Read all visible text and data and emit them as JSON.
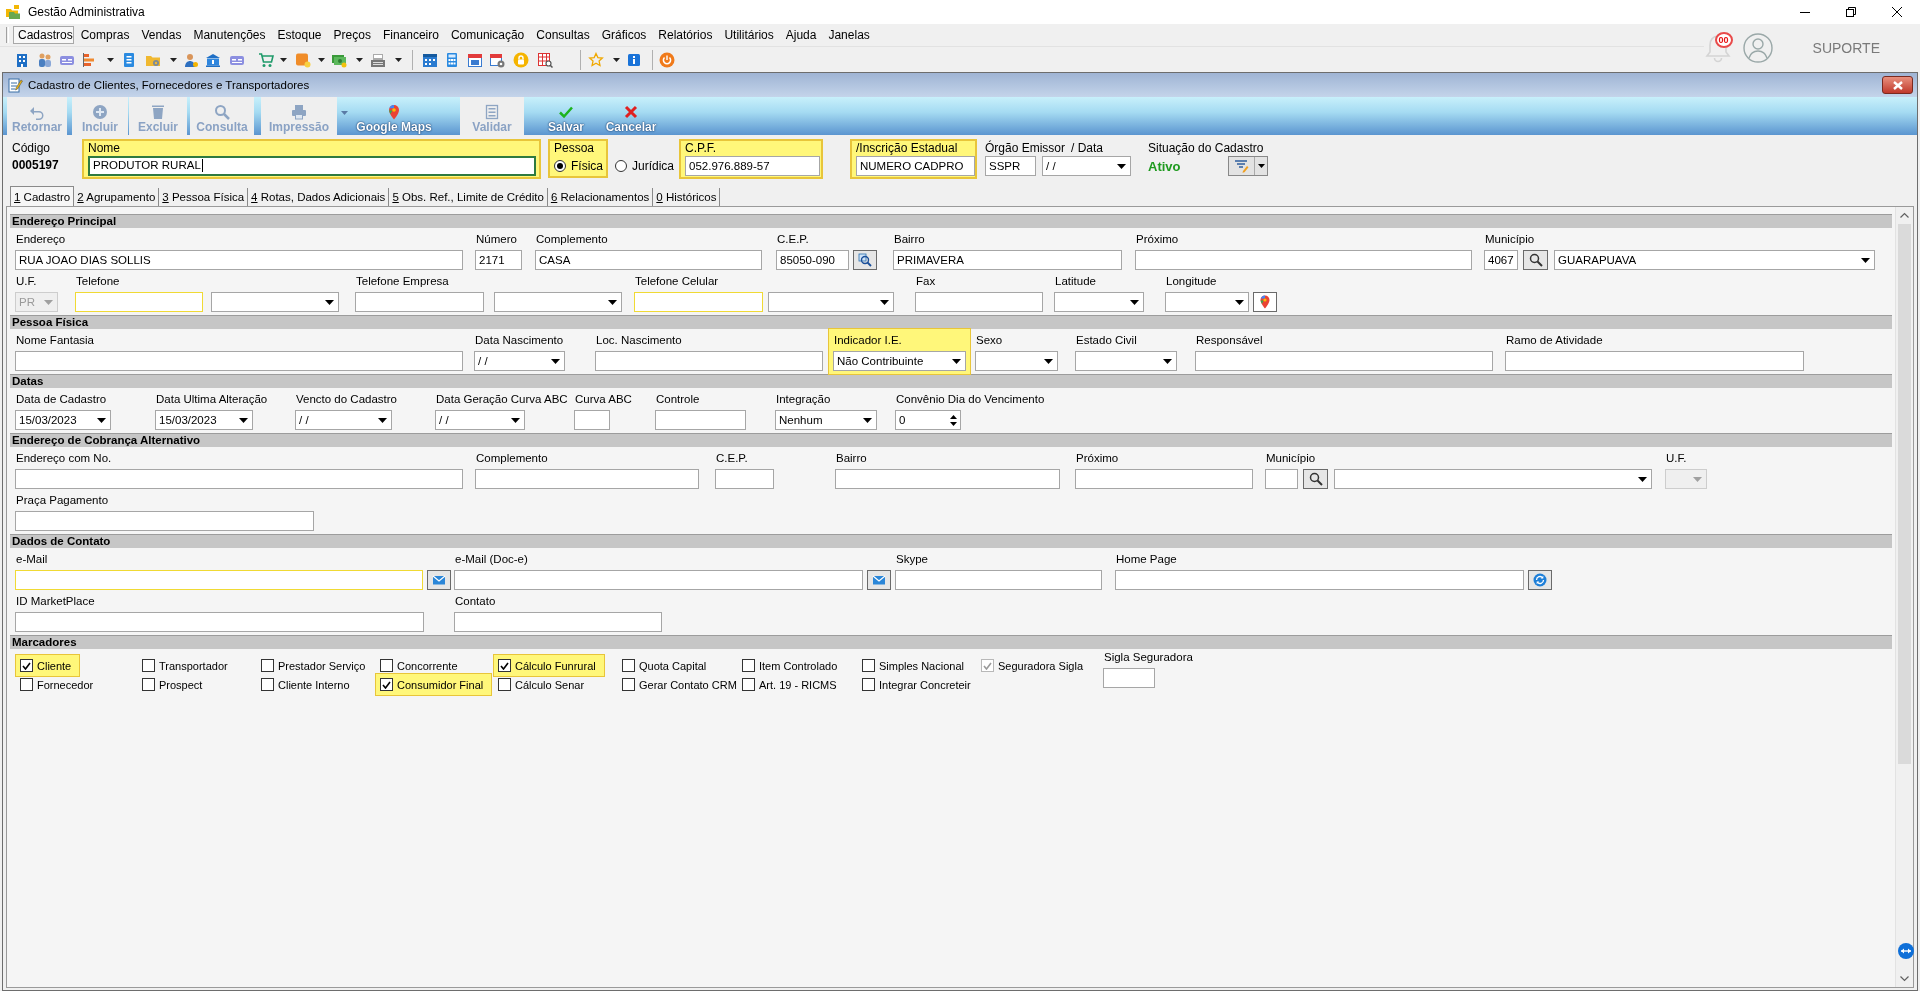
{
  "app": {
    "title": "Gestão Administrativa",
    "menu": [
      {
        "label": "Cadastros",
        "selected": true
      },
      {
        "label": "Compras",
        "selected": false
      },
      {
        "label": "Vendas",
        "selected": false
      },
      {
        "label": "Manutenções",
        "selected": false
      },
      {
        "label": "Estoque",
        "selected": false
      },
      {
        "label": "Preços",
        "selected": false
      },
      {
        "label": "Financeiro",
        "selected": false
      },
      {
        "label": "Comunicação",
        "selected": false
      },
      {
        "label": "Consultas",
        "selected": false
      },
      {
        "label": "Gráficos",
        "selected": false
      },
      {
        "label": "Relatórios",
        "selected": false
      },
      {
        "label": "Utilitários",
        "selected": false
      },
      {
        "label": "Ajuda",
        "selected": false
      },
      {
        "label": "Janelas",
        "selected": false
      }
    ],
    "notifications": "00",
    "support": "SUPORTE"
  },
  "form_window": {
    "title": "Cadastro de Clientes, Fornecedores e Transportadores",
    "toolbar": [
      {
        "label": "Retornar",
        "disabled": true
      },
      {
        "label": "Incluir",
        "disabled": true
      },
      {
        "label": "Excluir",
        "disabled": true
      },
      {
        "label": "Consulta",
        "disabled": true
      },
      {
        "label": "Impressão",
        "disabled": true,
        "dropdown": true
      },
      {
        "label": "Google Maps",
        "disabled": false
      },
      {
        "label": "Validar",
        "disabled": true
      },
      {
        "label": "Salvar",
        "disabled": false
      },
      {
        "label": "Cancelar",
        "disabled": false
      }
    ]
  },
  "record": {
    "code": {
      "label": "Código",
      "value": "0005197"
    },
    "name": {
      "label": "Nome",
      "value": "PRODUTOR RURAL",
      "highlighted": true,
      "focused": true
    },
    "person_type": {
      "label": "Pessoa",
      "highlighted": true,
      "options": [
        {
          "label": "Física",
          "selected": true
        },
        {
          "label": "Jurídica",
          "selected": false
        }
      ]
    },
    "cpf": {
      "label": "C.P.F.",
      "value": "052.976.889-57",
      "highlighted": true
    },
    "state_registration": {
      "label": "/Inscrição Estadual",
      "value": "NUMERO CADPRO",
      "highlighted": true
    },
    "issuer": {
      "label": "Órgão Emissor",
      "value": "SSPR",
      "date_label": "/ Data",
      "date": "/ /"
    },
    "status": {
      "label": "Situação do Cadastro",
      "value": "Ativo"
    }
  },
  "tabs": [
    {
      "label": "1 Cadastro",
      "selected": true
    },
    {
      "label": "2 Agrupamento",
      "selected": false
    },
    {
      "label": "3 Pessoa Física",
      "selected": false
    },
    {
      "label": "4 Rotas, Dados Adicionais",
      "selected": false
    },
    {
      "label": "5 Obs. Ref., Limite de Crédito",
      "selected": false
    },
    {
      "label": "6 Relacionamentos",
      "selected": false
    },
    {
      "label": "0 Históricos",
      "selected": false
    }
  ],
  "sections": [
    {
      "title": "Endereço Principal",
      "fields": [
        {
          "label": "Endereço",
          "kind": "text",
          "value": "RUA JOAO DIAS SOLLIS",
          "disabled": false,
          "required": false,
          "highlighted": false
        },
        {
          "label": "Número",
          "kind": "text",
          "value": "2171",
          "disabled": false,
          "required": false,
          "highlighted": false
        },
        {
          "label": "Complemento",
          "kind": "text",
          "value": "CASA",
          "disabled": false,
          "required": false,
          "highlighted": false
        },
        {
          "label": "C.E.P.",
          "kind": "text",
          "value": "85050-090",
          "disabled": false,
          "required": false,
          "highlighted": false
        },
        {
          "label": "Bairro",
          "kind": "text",
          "value": "PRIMAVERA",
          "disabled": false,
          "required": false,
          "highlighted": false
        },
        {
          "label": "Próximo",
          "kind": "text",
          "disabled": false,
          "required": false,
          "highlighted": false
        },
        {
          "label": "Município",
          "kind": "lookup",
          "value": "4067",
          "selection": "GUARAPUAVA",
          "disabled": false,
          "required": false,
          "highlighted": false
        },
        {
          "label": "U.F.",
          "kind": "select",
          "value": "PR",
          "disabled": true,
          "required": false,
          "highlighted": false
        },
        {
          "label": "Telefone",
          "kind": "text",
          "disabled": false,
          "required": true,
          "highlighted": false
        },
        {
          "kind": "select",
          "disabled": false,
          "required": false,
          "highlighted": false
        },
        {
          "label": "Telefone Empresa",
          "kind": "text",
          "disabled": false,
          "required": false,
          "highlighted": false
        },
        {
          "kind": "select",
          "disabled": false,
          "required": false,
          "highlighted": false
        },
        {
          "label": "Telefone Celular",
          "kind": "text",
          "disabled": false,
          "required": true,
          "highlighted": false
        },
        {
          "kind": "select",
          "disabled": false,
          "required": false,
          "highlighted": false
        },
        {
          "label": "Fax",
          "kind": "text",
          "disabled": false,
          "required": false,
          "highlighted": false
        },
        {
          "label": "Latitude",
          "kind": "select",
          "disabled": false,
          "required": false,
          "highlighted": false
        },
        {
          "label": "Longitude",
          "kind": "select",
          "disabled": false,
          "required": false,
          "highlighted": false
        }
      ]
    },
    {
      "title": "Pessoa Física",
      "fields": [
        {
          "label": "Nome Fantasia",
          "kind": "text",
          "disabled": false,
          "required": false,
          "highlighted": false
        },
        {
          "label": "Data Nascimento",
          "kind": "select",
          "value": "/ /",
          "disabled": false,
          "required": false,
          "highlighted": false
        },
        {
          "label": "Loc. Nascimento",
          "kind": "text",
          "disabled": false,
          "required": false,
          "highlighted": false
        },
        {
          "label": "Indicador I.E.",
          "kind": "select",
          "value": "Não Contribuinte",
          "disabled": false,
          "required": false,
          "highlighted": true
        },
        {
          "label": "Sexo",
          "kind": "select",
          "disabled": false,
          "required": false,
          "highlighted": false
        },
        {
          "label": "Estado Civil",
          "kind": "select",
          "disabled": false,
          "required": false,
          "highlighted": false
        },
        {
          "label": "Responsável",
          "kind": "text",
          "disabled": false,
          "required": false,
          "highlighted": false
        },
        {
          "label": "Ramo de Atividade",
          "kind": "text",
          "disabled": false,
          "required": false,
          "highlighted": false
        }
      ]
    },
    {
      "title": "Datas",
      "fields": [
        {
          "label": "Data de Cadastro",
          "kind": "select",
          "value": "15/03/2023",
          "disabled": false,
          "required": false,
          "highlighted": false
        },
        {
          "label": "Data Ultima Alteração",
          "kind": "select",
          "value": "15/03/2023",
          "disabled": false,
          "required": false,
          "highlighted": false
        },
        {
          "label": "Vencto do Cadastro",
          "kind": "select",
          "value": "/ /",
          "disabled": false,
          "required": false,
          "highlighted": false
        },
        {
          "label": "Data Geração Curva ABC",
          "kind": "select",
          "value": "/ /",
          "disabled": false,
          "required": false,
          "highlighted": false
        },
        {
          "label": "Curva ABC",
          "kind": "text",
          "disabled": false,
          "required": false,
          "highlighted": false
        },
        {
          "label": "Controle",
          "kind": "text",
          "disabled": false,
          "required": false,
          "highlighted": false
        },
        {
          "label": "Integração",
          "kind": "select",
          "value": "Nenhum",
          "disabled": false,
          "required": false,
          "highlighted": false
        },
        {
          "label": "Convênio Dia do Vencimento",
          "kind": "spin",
          "value": "0",
          "disabled": false,
          "required": false,
          "highlighted": false
        }
      ]
    },
    {
      "title": "Endereço de Cobrança Alternativo",
      "fields": [
        {
          "label": "Endereço com No.",
          "kind": "text",
          "disabled": false,
          "required": false,
          "highlighted": false
        },
        {
          "label": "Complemento",
          "kind": "text",
          "disabled": false,
          "required": false,
          "highlighted": false
        },
        {
          "label": "C.E.P.",
          "kind": "text",
          "disabled": false,
          "required": false,
          "highlighted": false
        },
        {
          "label": "Bairro",
          "kind": "text",
          "disabled": false,
          "required": false,
          "highlighted": false
        },
        {
          "label": "Próximo",
          "kind": "text",
          "disabled": false,
          "required": false,
          "highlighted": false
        },
        {
          "label": "Município",
          "kind": "lookup",
          "disabled": false,
          "required": false,
          "highlighted": false
        },
        {
          "label": "U.F.",
          "kind": "select",
          "disabled": true,
          "required": false,
          "highlighted": false
        },
        {
          "label": "Praça Pagamento",
          "kind": "text",
          "disabled": false,
          "required": false,
          "highlighted": false
        }
      ]
    },
    {
      "title": "Dados de Contato",
      "fields": [
        {
          "label": "e-Mail",
          "kind": "text",
          "disabled": false,
          "required": true,
          "highlighted": false
        },
        {
          "label": "e-Mail (Doc-e)",
          "kind": "text",
          "disabled": false,
          "required": false,
          "highlighted": false
        },
        {
          "label": "Skype",
          "kind": "text",
          "disabled": false,
          "required": false,
          "highlighted": false
        },
        {
          "label": "Home Page",
          "kind": "text",
          "disabled": false,
          "required": false,
          "highlighted": false
        },
        {
          "label": "ID MarketPlace",
          "kind": "text",
          "disabled": false,
          "required": false,
          "highlighted": false
        },
        {
          "label": "Contato",
          "kind": "text",
          "disabled": false,
          "required": false,
          "highlighted": false
        }
      ]
    }
  ],
  "markers": {
    "title": "Marcadores",
    "rows": [
      [
        {
          "label": "Cliente",
          "checked": true,
          "highlighted": true,
          "disabled": false
        },
        {
          "label": "Transportador",
          "checked": false,
          "highlighted": false,
          "disabled": false
        },
        {
          "label": "Prestador Serviço",
          "checked": false,
          "highlighted": false,
          "disabled": false
        },
        {
          "label": "Concorrente",
          "checked": false,
          "highlighted": false,
          "disabled": false
        },
        {
          "label": "Cálculo Funrural",
          "checked": true,
          "highlighted": true,
          "disabled": false
        },
        {
          "label": "Quota Capital",
          "checked": false,
          "highlighted": false,
          "disabled": false
        },
        {
          "label": "Item Controlado",
          "checked": false,
          "highlighted": false,
          "disabled": false
        },
        {
          "label": "Simples Nacional",
          "checked": false,
          "highlighted": false,
          "disabled": false
        },
        {
          "label": "Seguradora Sigla",
          "checked": true,
          "highlighted": false,
          "disabled": true
        }
      ],
      [
        {
          "label": "Fornecedor",
          "checked": false,
          "highlighted": false,
          "disabled": false
        },
        {
          "label": "Prospect",
          "checked": false,
          "highlighted": false,
          "disabled": false
        },
        {
          "label": "Cliente Interno",
          "checked": false,
          "highlighted": false,
          "disabled": false
        },
        {
          "label": "Consumidor Final",
          "checked": true,
          "highlighted": true,
          "disabled": false
        },
        {
          "label": "Cálculo Senar",
          "checked": false,
          "highlighted": false,
          "disabled": false
        },
        {
          "label": "Gerar Contato CRM",
          "checked": false,
          "highlighted": false,
          "disabled": false
        },
        {
          "label": "Art. 19 - RICMS",
          "checked": false,
          "highlighted": false,
          "disabled": false
        },
        {
          "label": "Integrar Concreteir",
          "checked": false,
          "highlighted": false,
          "disabled": false
        }
      ]
    ],
    "sigla": {
      "label": "Sigla Seguradora"
    }
  }
}
